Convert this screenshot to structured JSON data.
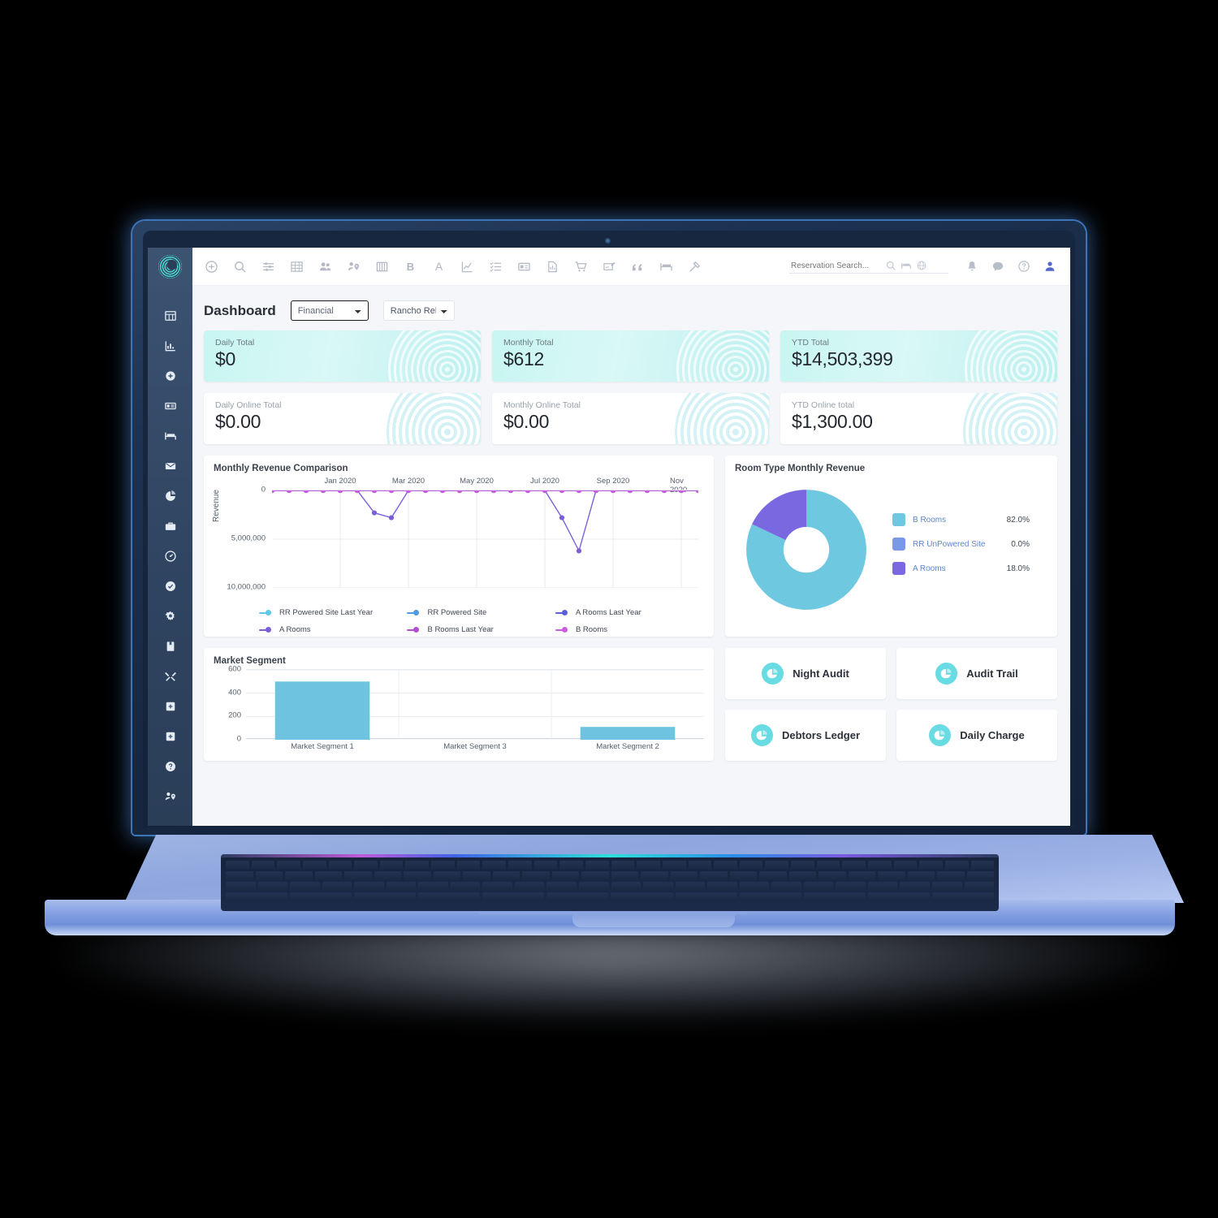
{
  "app": {
    "logo_icon": "concentric-circles-logo",
    "toolbar_icons": [
      "plus-circle-icon",
      "search-icon",
      "filters-icon",
      "grid-table-icon",
      "people-icon",
      "person-location-icon",
      "book-open-icon",
      "bold-b-icon",
      "letter-a-icon",
      "line-chart-icon",
      "checklist-icon",
      "id-card-icon",
      "document-chart-icon",
      "shopping-cart-icon",
      "sign-edit-icon",
      "quote-icon",
      "bed-icon",
      "hammer-icon"
    ],
    "toolbar_right_icons": [
      "bell-icon",
      "chat-icon",
      "help-icon",
      "user-icon"
    ],
    "search": {
      "placeholder": "Reservation Search...",
      "value": "",
      "icons": [
        "search-icon",
        "bed-icon",
        "globe-icon"
      ]
    }
  },
  "sidebar": {
    "items": [
      {
        "name": "grid-table",
        "icon": "grid-table-icon"
      },
      {
        "name": "reports",
        "icon": "bar-chart-icon"
      },
      {
        "name": "add",
        "icon": "plus-circle-icon"
      },
      {
        "name": "id-card",
        "icon": "id-card-icon"
      },
      {
        "name": "rooms",
        "icon": "bed-icon"
      },
      {
        "name": "messages",
        "icon": "envelope-icon"
      },
      {
        "name": "analytics",
        "icon": "pie-chart-icon"
      },
      {
        "name": "briefcase",
        "icon": "briefcase-icon"
      },
      {
        "name": "dashboard-gauge",
        "icon": "gauge-icon"
      },
      {
        "name": "tasks",
        "icon": "check-circle-icon"
      },
      {
        "name": "settings",
        "icon": "gear-icon"
      },
      {
        "name": "ledger",
        "icon": "book-icon"
      },
      {
        "name": "maintenance",
        "icon": "tools-icon"
      },
      {
        "name": "add-box-1",
        "icon": "plus-box-icon"
      },
      {
        "name": "add-box-2",
        "icon": "plus-box-icon"
      },
      {
        "name": "help",
        "icon": "question-circle-icon"
      },
      {
        "name": "groups",
        "icon": "people-group-icon"
      }
    ]
  },
  "page": {
    "title": "Dashboard",
    "type_select": {
      "value": "Financial",
      "options": [
        "Financial"
      ]
    },
    "property_select": {
      "value": "Rancho Relaxo",
      "options": [
        "Rancho Relaxo"
      ]
    }
  },
  "kpis": [
    {
      "label": "Daily Total",
      "value": "$0",
      "style": "teal"
    },
    {
      "label": "Monthly Total",
      "value": "$612",
      "style": "teal"
    },
    {
      "label": "YTD Total",
      "value": "$14,503,399",
      "style": "teal"
    },
    {
      "label": "Daily Online Total",
      "value": "$0.00",
      "style": "white"
    },
    {
      "label": "Monthly Online Total",
      "value": "$0.00",
      "style": "white"
    },
    {
      "label": "YTD Online total",
      "value": "$1,300.00",
      "style": "white"
    }
  ],
  "tiles": [
    {
      "label": "Night Audit",
      "icon": "pie-chart-icon"
    },
    {
      "label": "Audit Trail",
      "icon": "pie-chart-icon"
    },
    {
      "label": "Debtors Ledger",
      "icon": "pie-chart-icon"
    },
    {
      "label": "Daily Charge",
      "icon": "pie-chart-icon"
    }
  ],
  "chart_data": [
    {
      "id": "monthly_revenue_comparison",
      "type": "line",
      "title": "Monthly Revenue Comparison",
      "xlabel": "",
      "ylabel": "Revenue",
      "ylim": [
        0,
        10000000
      ],
      "y_inverted": true,
      "ytick_labels": [
        "0",
        "5,000,000",
        "10,000,000"
      ],
      "yticks": [
        0,
        5000000,
        10000000
      ],
      "xtick_labels": [
        "Jan 2020",
        "Mar 2020",
        "May 2020",
        "Jul 2020",
        "Sep 2020",
        "Nov 2020"
      ],
      "xtick_positions": [
        4,
        8,
        12,
        16,
        20,
        24
      ],
      "x_count": 26,
      "grid": true,
      "legend_position": "bottom",
      "series": [
        {
          "name": "RR Powered Site Last Year",
          "color": "#5ec8e8",
          "values": [
            0,
            0,
            0,
            0,
            0,
            0,
            0,
            0,
            0,
            0,
            0,
            0,
            0,
            0,
            0,
            0,
            0,
            0,
            0,
            0,
            0,
            0,
            0,
            0,
            0,
            0
          ]
        },
        {
          "name": "RR Powered Site",
          "color": "#4f9ae0",
          "values": [
            0,
            0,
            0,
            0,
            0,
            0,
            0,
            0,
            0,
            0,
            0,
            0,
            0,
            0,
            0,
            0,
            0,
            0,
            0,
            0,
            0,
            0,
            0,
            0,
            0,
            0
          ]
        },
        {
          "name": "A Rooms Last Year",
          "color": "#5b5fd8",
          "values": [
            0,
            0,
            0,
            0,
            0,
            0,
            0,
            0,
            0,
            0,
            0,
            0,
            0,
            0,
            0,
            0,
            0,
            0,
            0,
            0,
            0,
            0,
            0,
            0,
            0,
            0
          ]
        },
        {
          "name": "A Rooms",
          "color": "#7c5fd8",
          "values": [
            0,
            0,
            0,
            0,
            0,
            0,
            2300000,
            2800000,
            0,
            0,
            0,
            0,
            0,
            0,
            0,
            0,
            0,
            2800000,
            6200000,
            0,
            0,
            0,
            0,
            0,
            0,
            0
          ]
        },
        {
          "name": "B Rooms Last Year",
          "color": "#b14fd0",
          "values": [
            0,
            0,
            0,
            0,
            0,
            0,
            0,
            0,
            0,
            0,
            0,
            0,
            0,
            0,
            0,
            0,
            0,
            0,
            0,
            0,
            0,
            0,
            0,
            0,
            0,
            0
          ]
        },
        {
          "name": "B Rooms",
          "color": "#cc5ae0",
          "values": [
            0,
            0,
            0,
            0,
            0,
            0,
            0,
            0,
            0,
            0,
            0,
            0,
            0,
            0,
            0,
            0,
            0,
            0,
            0,
            0,
            0,
            0,
            0,
            0,
            0,
            0
          ]
        }
      ]
    },
    {
      "id": "room_type_monthly_revenue",
      "type": "pie",
      "title": "Room Type Monthly Revenue",
      "donut": true,
      "legend_position": "right",
      "labels": [
        "B Rooms",
        "RR UnPowered Site",
        "A Rooms"
      ],
      "values": [
        82.0,
        0.0,
        18.0
      ],
      "value_labels": [
        "82.0%",
        "0.0%",
        "18.0%"
      ],
      "colors": [
        "#6ec8e0",
        "#7b97e8",
        "#7968e0"
      ]
    },
    {
      "id": "market_segment",
      "type": "bar",
      "title": "Market Segment",
      "xlabel": "",
      "ylabel": "",
      "ylim": [
        0,
        600
      ],
      "ytick_labels": [
        "0",
        "200",
        "400",
        "600"
      ],
      "yticks": [
        0,
        200,
        400,
        600
      ],
      "categories": [
        "Market Segment 1",
        "Market Segment 3",
        "Market Segment 2"
      ],
      "values": [
        500,
        0,
        110
      ],
      "color": "#6ec4e0",
      "grid": true
    }
  ]
}
